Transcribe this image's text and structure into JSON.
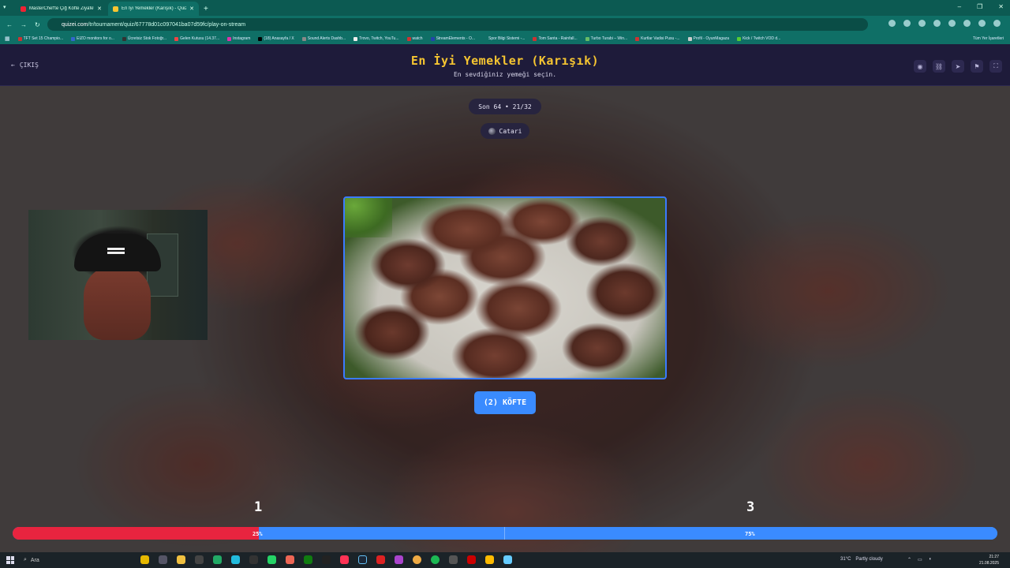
{
  "browser": {
    "tabs": [
      {
        "title": "MasterChef'te Çiğ Köfte Ziyafeti",
        "active": false
      },
      {
        "title": "En İyi Yemekler (Karışık) - Quizi",
        "active": true
      }
    ],
    "url_host": "quizei.com",
    "url_path": "/tr/tournament/quiz/67778d01c097041ba07d59fc/play-on-stream",
    "bookmarks": [
      "TFT Set 15 Champio...",
      "EIZO monitors for o...",
      "Ücretsiz Stok Fotoğr...",
      "Gelen Kutusu (14.37...",
      "Instagram",
      "(18) Anasayfa / X",
      "Sound Alerts Dashb...",
      "Trovo, Twitch, YouTu...",
      "watch",
      "StreamElements - O...",
      "Spor Bilgi Sistemi -...",
      "Tom Santa - Rainfall...",
      "Turbo Turabi – Win...",
      "Kurtlar Vadisi Pusu -...",
      "Profil - OyunMagaza",
      "Kick / Twitch VOD d..."
    ],
    "bookmarks_all": "Tüm Yer İşaretleri"
  },
  "header": {
    "exit_label": "ÇIKIŞ",
    "title": "En İyi Yemekler (Karışık)",
    "subtitle": "En sevdiğiniz yemeği seçin."
  },
  "round": {
    "label": "Son 64 • 21/32",
    "user": "Catari"
  },
  "choice": {
    "button_label": "(2) KÖFTE"
  },
  "votes": {
    "left_count": "1",
    "right_count": "3",
    "left_pct_label": "25%",
    "right_pct_label": "75%",
    "left_fraction": 0.25,
    "colors": {
      "left": "#e8243f",
      "right": "#3a8bff"
    }
  },
  "taskbar": {
    "search_placeholder": "Ara",
    "weather": "31°C",
    "weather_desc": "Partly cloudy",
    "time": "21:27",
    "date": "21.08.2025"
  }
}
